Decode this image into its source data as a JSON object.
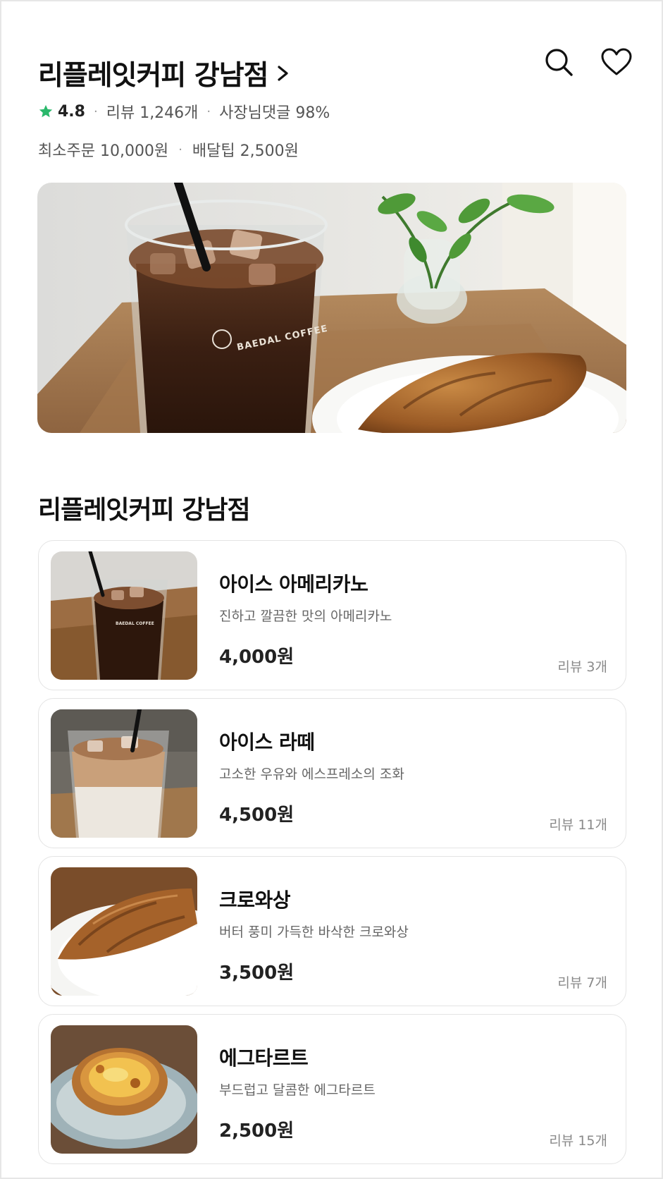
{
  "store": {
    "name": "리플레잇커피 강남점",
    "rating": "4.8",
    "reviews": "리뷰 1,246개",
    "owner_reply": "사장님댓글 98%",
    "min_order": "최소주문 10,000원",
    "delivery_tip": "배달팁 2,500원",
    "section_title": "리플레잇커피 강남점",
    "hero_cup_text": "BAEDAL COFFEE"
  },
  "icons": {
    "star": "star-icon",
    "search": "search-icon",
    "favorite": "heart-icon",
    "chevron": "chevron-right-icon"
  },
  "colors": {
    "star": "#2ab86b",
    "text_primary": "#111111",
    "text_secondary": "#666666",
    "border": "#e4e4e4"
  },
  "menu": [
    {
      "name": "아이스 아메리카노",
      "desc": "진하고 깔끔한 맛의 아메리카노",
      "price": "4,000원",
      "reviews": "리뷰 3개",
      "cup_text": "BAEDAL COFFEE"
    },
    {
      "name": "아이스 라떼",
      "desc": "고소한 우유와 에스프레소의 조화",
      "price": "4,500원",
      "reviews": "리뷰 11개"
    },
    {
      "name": "크로와상",
      "desc": "버터 풍미 가득한 바삭한 크로와상",
      "price": "3,500원",
      "reviews": "리뷰 7개"
    },
    {
      "name": "에그타르트",
      "desc": "부드럽고 달콤한 에그타르트",
      "price": "2,500원",
      "reviews": "리뷰 15개"
    }
  ]
}
